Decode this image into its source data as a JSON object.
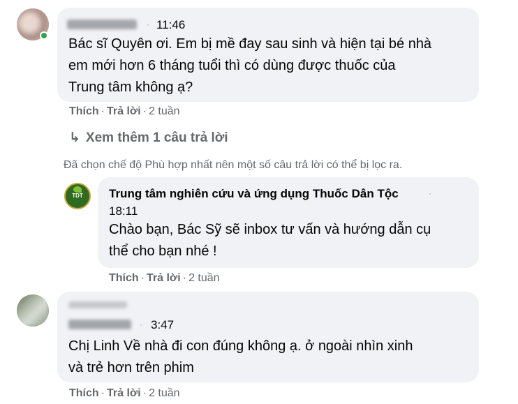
{
  "comments": [
    {
      "time": "11:46",
      "text_lines": [
        "Bác sĩ Quyên ơi. Em bị mề đay sau sinh và hiện tại bé nhà",
        "em mới hơn 6 tháng tuổi thì có dùng được thuốc của",
        "Trung tâm không ạ?"
      ],
      "like": "Thích",
      "reply": "Trả lời",
      "age": "2 tuần"
    },
    {
      "name": "Trung tâm nghiên cứu và ứng dụng Thuốc Dân Tộc",
      "time": "18:11",
      "avatar_text": "TDT",
      "text_lines": [
        "Chào bạn, Bác Sỹ sẽ inbox tư vấn và hướng dẫn cụ",
        "thể cho bạn nhé !"
      ],
      "like": "Thích",
      "reply": "Trả lời",
      "age": "2 tuần"
    },
    {
      "time": "3:47",
      "text_lines": [
        "Chị Linh Về nhà đi con đúng không ạ. ở ngoài nhìn xinh",
        "và trẻ hơn trên phim"
      ],
      "like": "Thích",
      "reply": "Trả lời",
      "age": "2 tuần"
    }
  ],
  "more_replies": "Xem thêm 1 câu trả lời",
  "filter_note": "Đã chọn chế độ Phù hợp nhất nên một số câu trả lời có thể bị lọc ra.",
  "separator": "·",
  "colors": {
    "bubble": "#f0f2f5",
    "meta": "#65676b",
    "online": "#31a24c",
    "brand": "#2e6b1f"
  }
}
